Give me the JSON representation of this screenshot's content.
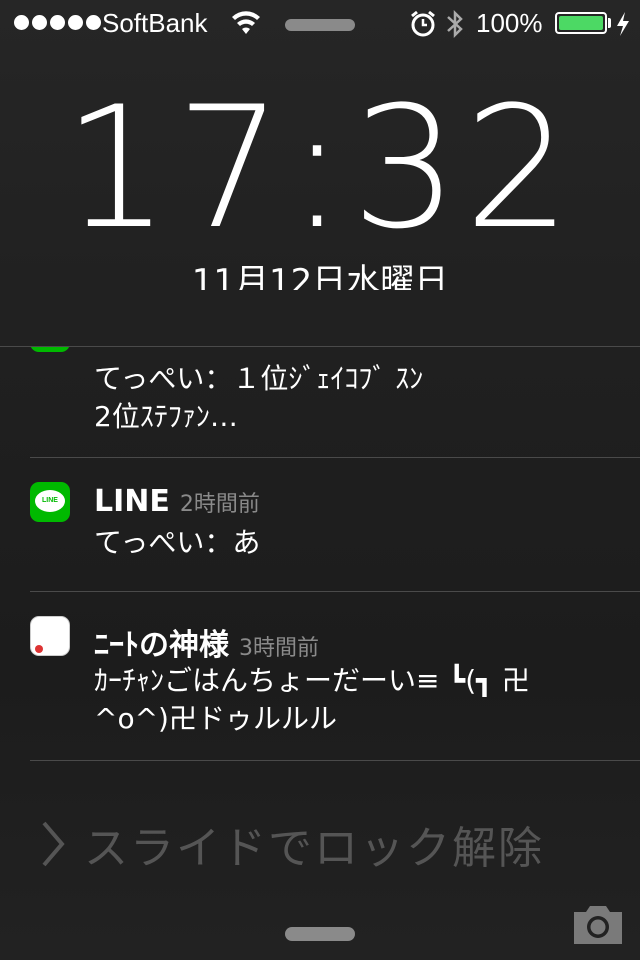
{
  "status_bar": {
    "carrier": "SoftBank",
    "signal_bars": 5,
    "battery_percent": "100%",
    "battery_level": 1.0,
    "battery_color": "#4cd964",
    "icons": [
      "wifi-icon",
      "alarm-icon",
      "bluetooth-icon",
      "charging-icon"
    ]
  },
  "lock": {
    "time": "17:32",
    "date": "11月12日水曜日"
  },
  "notifications": [
    {
      "app_icon": "line-icon",
      "app": "",
      "ago": "",
      "message_line1": "てっぺい：１位ｼﾞｪｲｺﾌﾞ ｽﾝ",
      "message_line2": "2位ｽﾃﾌｧﾝ…"
    },
    {
      "app_icon": "line-icon",
      "app": "LINE",
      "ago": "2時間前",
      "message_line1": "てっぺい：あ",
      "message_line2": ""
    },
    {
      "app_icon": "neet-app-icon",
      "app": "ﾆｰﾄの神様",
      "ago": "3時間前",
      "message_line1": "ｶｰﾁｬﾝごはんちょーだーい≡ ┗(┓ 卍",
      "message_line2": "^o^)卍ドゥルルル"
    }
  ],
  "line_icon_label": "LINE",
  "slide_to_unlock": "スライドでロック解除",
  "accent_line_green": "#00b900"
}
